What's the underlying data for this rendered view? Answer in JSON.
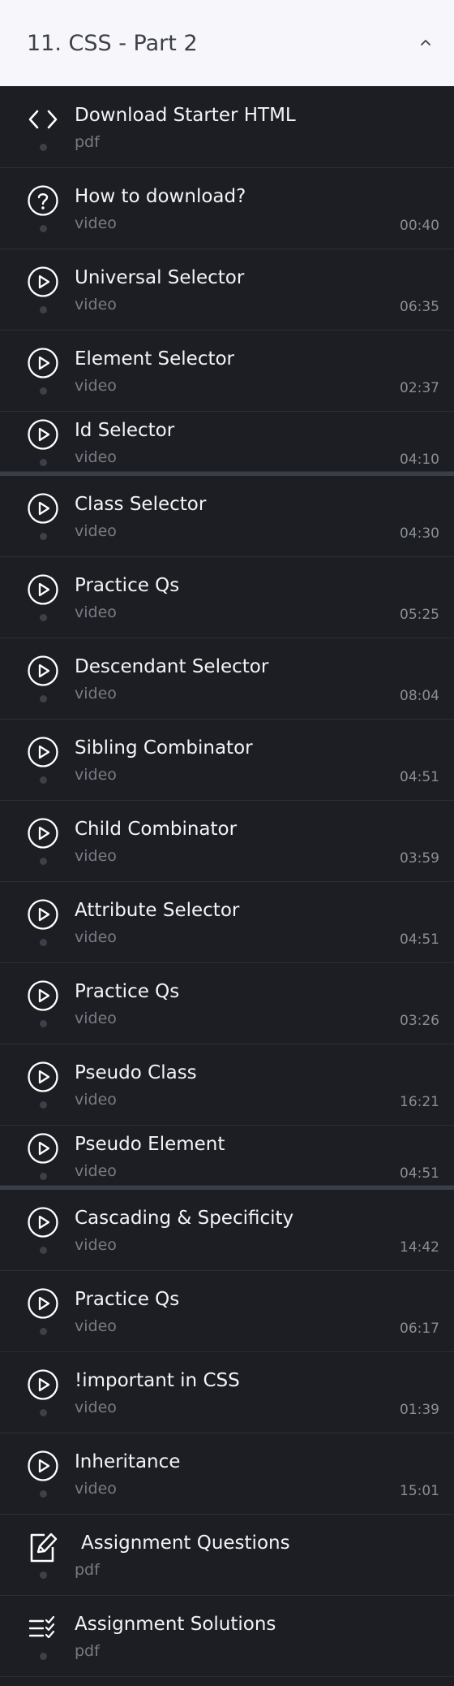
{
  "section": {
    "title": "11. CSS - Part 2"
  },
  "items": [
    {
      "icon": "code-icon",
      "title": "Download Starter HTML",
      "type": "pdf",
      "duration": ""
    },
    {
      "icon": "question-circle-icon",
      "title": "How to download?",
      "type": "video",
      "duration": "00:40"
    },
    {
      "icon": "play-circle-icon",
      "title": "Universal Selector",
      "type": "video",
      "duration": "06:35"
    },
    {
      "icon": "play-circle-icon",
      "title": "Element Selector",
      "type": "video",
      "duration": "02:37"
    },
    {
      "icon": "play-circle-icon",
      "title": "Id Selector",
      "type": "video",
      "duration": "04:10"
    },
    {
      "icon": "play-circle-icon",
      "title": "Class Selector",
      "type": "video",
      "duration": "04:30"
    },
    {
      "icon": "play-circle-icon",
      "title": "Practice Qs",
      "type": "video",
      "duration": "05:25"
    },
    {
      "icon": "play-circle-icon",
      "title": "Descendant Selector",
      "type": "video",
      "duration": "08:04"
    },
    {
      "icon": "play-circle-icon",
      "title": "Sibling Combinator",
      "type": "video",
      "duration": "04:51"
    },
    {
      "icon": "play-circle-icon",
      "title": "Child Combinator",
      "type": "video",
      "duration": "03:59"
    },
    {
      "icon": "play-circle-icon",
      "title": "Attribute Selector",
      "type": "video",
      "duration": "04:51"
    },
    {
      "icon": "play-circle-icon",
      "title": "Practice Qs",
      "type": "video",
      "duration": "03:26"
    },
    {
      "icon": "play-circle-icon",
      "title": "Pseudo Class",
      "type": "video",
      "duration": "16:21"
    },
    {
      "icon": "play-circle-icon",
      "title": "Pseudo Element",
      "type": "video",
      "duration": "04:51"
    },
    {
      "icon": "play-circle-icon",
      "title": "Cascading & Specificity",
      "type": "video",
      "duration": "14:42"
    },
    {
      "icon": "play-circle-icon",
      "title": "Practice Qs",
      "type": "video",
      "duration": "06:17"
    },
    {
      "icon": "play-circle-icon",
      "title": "!important in CSS",
      "type": "video",
      "duration": "01:39"
    },
    {
      "icon": "play-circle-icon",
      "title": "Inheritance",
      "type": "video",
      "duration": "15:01"
    },
    {
      "icon": "edit-document-icon",
      "title": "Assignment Questions",
      "type": "pdf",
      "duration": ""
    },
    {
      "icon": "checklist-icon",
      "title": "Assignment Solutions",
      "type": "pdf",
      "duration": ""
    }
  ],
  "colors": {
    "header_bg": "#f7f7fb",
    "list_bg": "#1c1e23",
    "title_text": "#f3f4f6",
    "meta_text": "#777b84",
    "divider_bar": "#3a3e47"
  }
}
